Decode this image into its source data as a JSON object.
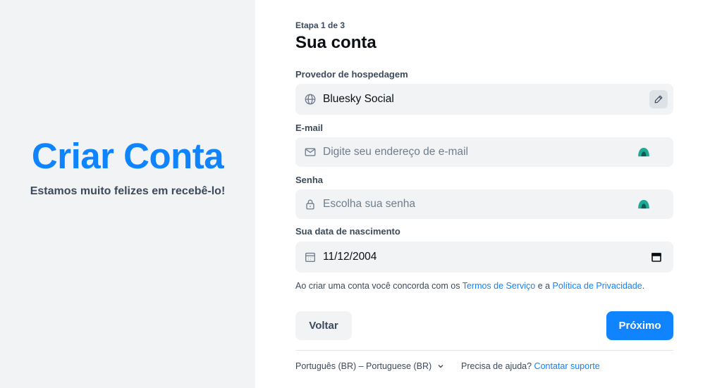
{
  "hero": {
    "title": "Criar Conta",
    "subtitle": "Estamos muito felizes em recebê-lo!"
  },
  "form": {
    "step": "Etapa 1 de 3",
    "title": "Sua conta",
    "provider": {
      "label": "Provedor de hospedagem",
      "value": "Bluesky Social",
      "icon": "globe-icon",
      "edit_icon": "pencil-icon"
    },
    "email": {
      "label": "E-mail",
      "placeholder": "Digite seu endereço de e-mail",
      "value": "",
      "icon": "envelope-icon"
    },
    "password": {
      "label": "Senha",
      "placeholder": "Escolha sua senha",
      "value": "",
      "icon": "lock-icon"
    },
    "birthdate": {
      "label": "Sua data de nascimento",
      "value": "11/12/2004",
      "icon": "calendar-icon"
    },
    "terms": {
      "prefix": "Ao criar uma conta você concorda com os ",
      "tos": "Termos de Serviço",
      "middle": " e a ",
      "privacy": "Política de Privacidade",
      "suffix": "."
    },
    "back_label": "Voltar",
    "next_label": "Próximo"
  },
  "footer": {
    "language": "Português (BR) – Portuguese (BR)",
    "help_prefix": "Precisa de ajuda? ",
    "help_link": "Contatar suporte"
  },
  "colors": {
    "accent": "#1083fe",
    "panel_bg": "#f1f3f5",
    "field_bg": "#f1f3f5",
    "text_muted": "#3c4a5b",
    "password_manager": "#1ea896"
  }
}
